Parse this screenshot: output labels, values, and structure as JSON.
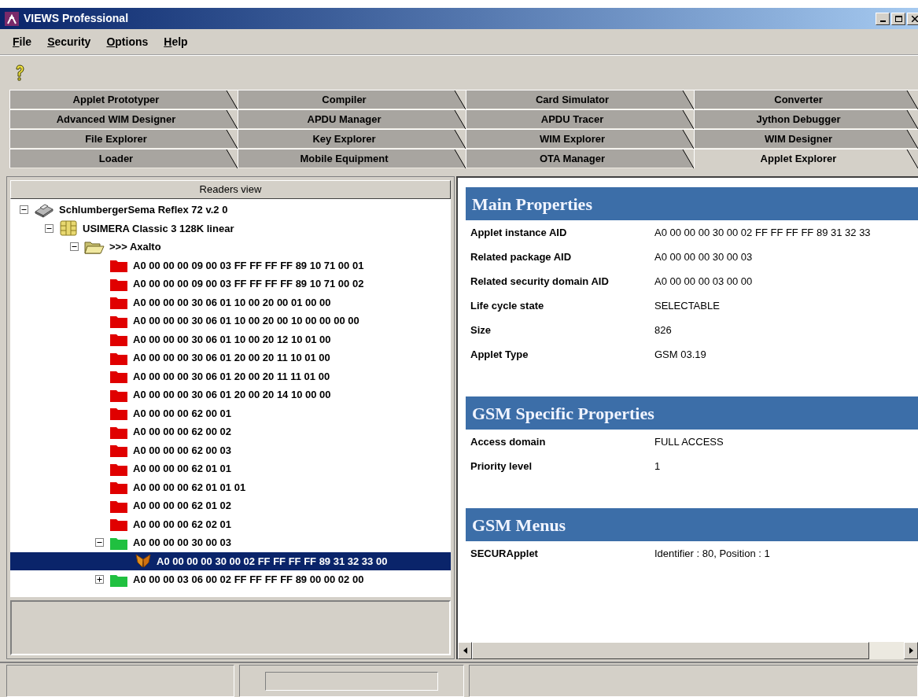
{
  "window": {
    "title": "VIEWS Professional"
  },
  "menu": [
    "File",
    "Security",
    "Options",
    "Help"
  ],
  "tab_rows": [
    [
      {
        "label": "Applet Prototyper",
        "selected": false
      },
      {
        "label": "Compiler",
        "selected": false
      },
      {
        "label": "Card Simulator",
        "selected": false
      },
      {
        "label": "Converter",
        "selected": false
      }
    ],
    [
      {
        "label": "Advanced WIM Designer",
        "selected": false
      },
      {
        "label": "APDU Manager",
        "selected": false
      },
      {
        "label": "APDU Tracer",
        "selected": false
      },
      {
        "label": "Jython Debugger",
        "selected": false
      }
    ],
    [
      {
        "label": "File Explorer",
        "selected": false
      },
      {
        "label": "Key Explorer",
        "selected": false
      },
      {
        "label": "WIM Explorer",
        "selected": false
      },
      {
        "label": "WIM Designer",
        "selected": false
      }
    ],
    [
      {
        "label": "Loader",
        "selected": false
      },
      {
        "label": "Mobile Equipment",
        "selected": false
      },
      {
        "label": "OTA Manager",
        "selected": false
      },
      {
        "label": "Applet Explorer",
        "selected": true
      }
    ]
  ],
  "readers_view": {
    "header": "Readers view",
    "tree": [
      {
        "kind": "reader",
        "label": "SchlumbergerSema Reflex 72 v.2 0",
        "expanded": true,
        "selected": false,
        "children": [
          {
            "kind": "card",
            "label": "USIMERA Classic 3 128K linear",
            "expanded": true,
            "selected": false,
            "children": [
              {
                "kind": "folder",
                "label": ">>> Axalto",
                "expanded": true,
                "selected": false,
                "children": [
                  {
                    "kind": "package",
                    "color": "#e00000",
                    "label": "A0 00 00 00 09 00 03 FF FF FF FF 89 10 71 00 01",
                    "selected": false
                  },
                  {
                    "kind": "package",
                    "color": "#e00000",
                    "label": "A0 00 00 00 09 00 03 FF FF FF FF 89 10 71 00 02",
                    "selected": false
                  },
                  {
                    "kind": "package",
                    "color": "#e00000",
                    "label": "A0 00 00 00 30 06 01 10 00 20 00 01 00 00",
                    "selected": false
                  },
                  {
                    "kind": "package",
                    "color": "#e00000",
                    "label": "A0 00 00 00 30 06 01 10 00 20 00 10 00 00 00 00",
                    "selected": false
                  },
                  {
                    "kind": "package",
                    "color": "#e00000",
                    "label": "A0 00 00 00 30 06 01 10 00 20 12 10 01 00",
                    "selected": false
                  },
                  {
                    "kind": "package",
                    "color": "#e00000",
                    "label": "A0 00 00 00 30 06 01 20 00 20 11 10 01 00",
                    "selected": false
                  },
                  {
                    "kind": "package",
                    "color": "#e00000",
                    "label": "A0 00 00 00 30 06 01 20 00 20 11 11 01 00",
                    "selected": false
                  },
                  {
                    "kind": "package",
                    "color": "#e00000",
                    "label": "A0 00 00 00 30 06 01 20 00 20 14 10 00 00",
                    "selected": false
                  },
                  {
                    "kind": "package",
                    "color": "#e00000",
                    "label": "A0 00 00 00 62 00 01",
                    "selected": false
                  },
                  {
                    "kind": "package",
                    "color": "#e00000",
                    "label": "A0 00 00 00 62 00 02",
                    "selected": false
                  },
                  {
                    "kind": "package",
                    "color": "#e00000",
                    "label": "A0 00 00 00 62 00 03",
                    "selected": false
                  },
                  {
                    "kind": "package",
                    "color": "#e00000",
                    "label": "A0 00 00 00 62 01 01",
                    "selected": false
                  },
                  {
                    "kind": "package",
                    "color": "#e00000",
                    "label": "A0 00 00 00 62 01 01 01",
                    "selected": false
                  },
                  {
                    "kind": "package",
                    "color": "#e00000",
                    "label": "A0 00 00 00 62 01 02",
                    "selected": false
                  },
                  {
                    "kind": "package",
                    "color": "#e00000",
                    "label": "A0 00 00 00 62 02 01",
                    "selected": false
                  },
                  {
                    "kind": "package",
                    "color": "#20c040",
                    "label": "A0 00 00 00 30 00 03",
                    "expanded": true,
                    "selected": false,
                    "children": [
                      {
                        "kind": "applet",
                        "label": "A0 00 00 00 30 00 02 FF FF FF FF 89 31 32 33 00",
                        "selected": true
                      }
                    ]
                  },
                  {
                    "kind": "package",
                    "color": "#20c040",
                    "label": "A0 00 00 03 06 00 02 FF FF FF FF 89 00 00 02 00",
                    "expanded": false,
                    "selected": false
                  }
                ]
              }
            ]
          }
        ]
      }
    ]
  },
  "properties": [
    {
      "title": "Main Properties",
      "rows": [
        {
          "label": "Applet instance AID",
          "value": "A0 00 00 00 30 00 02 FF FF FF FF 89 31 32 33"
        },
        {
          "label": "Related package AID",
          "value": "A0 00 00 00 30 00 03"
        },
        {
          "label": "Related security domain AID",
          "value": "A0 00 00 00 03 00 00"
        },
        {
          "label": "Life cycle state",
          "value": "SELECTABLE"
        },
        {
          "label": "Size",
          "value": "826"
        },
        {
          "label": "Applet Type",
          "value": "GSM 03.19"
        }
      ]
    },
    {
      "title": "GSM Specific Properties",
      "rows": [
        {
          "label": "Access domain",
          "value": "FULL ACCESS"
        },
        {
          "label": "Priority level",
          "value": "1"
        }
      ]
    },
    {
      "title": "GSM Menus",
      "rows": [
        {
          "label": "SECURApplet",
          "value": "Identifier : 80, Position : 1"
        }
      ]
    }
  ]
}
